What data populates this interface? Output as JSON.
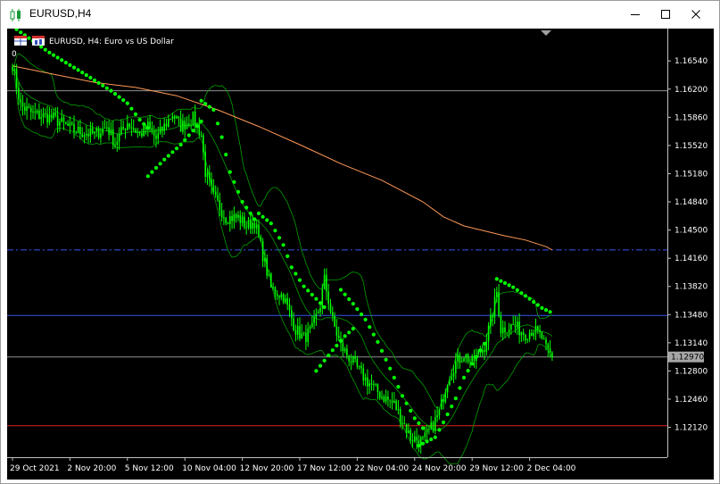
{
  "window": {
    "title": "EURUSD,H4",
    "minimize_icon": "minimize-icon",
    "maximize_icon": "maximize-icon",
    "close_icon": "close-icon"
  },
  "chart_info": {
    "symbol_line": "EURUSD, H4:  Euro vs US Dollar",
    "indicator_zero": "0"
  },
  "colors": {
    "background": "#000000",
    "candle": "#00ff00",
    "sar": "#00ff00",
    "bands": "#00a000",
    "ma": "#ff9955",
    "grid": "#606060",
    "price_label_bg": "#a6a6a6",
    "hline_blue": "#3355ee",
    "hline_red": "#dd2222",
    "hline_gray": "#909090"
  },
  "chart_data": {
    "type": "candlestick",
    "symbol": "EURUSD",
    "timeframe": "H4",
    "x_tick_labels": [
      "29 Oct 2021",
      "2 Nov 20:00",
      "5 Nov 12:00",
      "10 Nov 04:00",
      "12 Nov 20:00",
      "17 Nov 12:00",
      "22 Nov 04:00",
      "24 Nov 20:00",
      "29 Nov 12:00",
      "2 Dec 04:00"
    ],
    "y_ticks": [
      1.1654,
      1.162,
      1.1586,
      1.1552,
      1.1518,
      1.1484,
      1.145,
      1.1416,
      1.1382,
      1.1348,
      1.1314,
      1.128,
      1.1246,
      1.1212
    ],
    "y_tick_labels": [
      "1.16540",
      "1.16200",
      "1.15860",
      "1.15520",
      "1.15180",
      "1.14840",
      "1.14500",
      "1.14160",
      "1.13820",
      "1.13480",
      "1.13140",
      "1.12800",
      "1.12460",
      "1.12120"
    ],
    "ylim": [
      1.1176,
      1.1693
    ],
    "current_price": 1.1297,
    "current_price_label": "1.12970",
    "horizontal_lines": [
      {
        "price": 1.1618,
        "style": "solid",
        "color": "gray"
      },
      {
        "price": 1.1426,
        "style": "dash-dot",
        "color": "blue"
      },
      {
        "price": 1.1347,
        "style": "solid",
        "color": "blue"
      },
      {
        "price": 1.1297,
        "style": "solid",
        "color": "gray"
      },
      {
        "price": 1.1214,
        "style": "solid",
        "color": "red"
      }
    ],
    "close_path": [
      [
        0,
        1.165
      ],
      [
        4,
        1.16
      ],
      [
        10,
        1.159
      ],
      [
        20,
        1.1585
      ],
      [
        30,
        1.157
      ],
      [
        40,
        1.1565
      ],
      [
        46,
        1.1575
      ],
      [
        50,
        1.1555
      ],
      [
        56,
        1.158
      ],
      [
        62,
        1.1565
      ],
      [
        66,
        1.1575
      ],
      [
        70,
        1.156
      ],
      [
        78,
        1.159
      ],
      [
        82,
        1.1575
      ],
      [
        88,
        1.1585
      ],
      [
        92,
        1.1565
      ],
      [
        94,
        1.152
      ],
      [
        98,
        1.149
      ],
      [
        104,
        1.1465
      ],
      [
        110,
        1.1465
      ],
      [
        114,
        1.1455
      ],
      [
        118,
        1.146
      ],
      [
        122,
        1.142
      ],
      [
        126,
        1.138
      ],
      [
        132,
        1.137
      ],
      [
        138,
        1.133
      ],
      [
        142,
        1.132
      ],
      [
        146,
        1.133
      ],
      [
        150,
        1.136
      ],
      [
        152,
        1.139
      ],
      [
        156,
        1.134
      ],
      [
        160,
        1.131
      ],
      [
        166,
        1.129
      ],
      [
        172,
        1.127
      ],
      [
        176,
        1.126
      ],
      [
        180,
        1.125
      ],
      [
        186,
        1.124
      ],
      [
        190,
        1.122
      ],
      [
        194,
        1.12
      ],
      [
        200,
        1.1195
      ],
      [
        205,
        1.1215
      ],
      [
        208,
        1.123
      ],
      [
        212,
        1.127
      ],
      [
        216,
        1.129
      ],
      [
        220,
        1.13
      ],
      [
        224,
        1.129
      ],
      [
        230,
        1.131
      ],
      [
        234,
        1.135
      ],
      [
        236,
        1.1375
      ],
      [
        238,
        1.133
      ],
      [
        244,
        1.1335
      ],
      [
        250,
        1.1325
      ],
      [
        254,
        1.133
      ],
      [
        258,
        1.132
      ],
      [
        260,
        1.1305
      ],
      [
        263,
        1.1297
      ]
    ],
    "ma_path": [
      [
        0,
        1.1648
      ],
      [
        20,
        1.1638
      ],
      [
        40,
        1.1628
      ],
      [
        60,
        1.1622
      ],
      [
        80,
        1.1612
      ],
      [
        100,
        1.1595
      ],
      [
        120,
        1.1575
      ],
      [
        140,
        1.1553
      ],
      [
        160,
        1.153
      ],
      [
        180,
        1.151
      ],
      [
        200,
        1.1484
      ],
      [
        210,
        1.1466
      ],
      [
        220,
        1.1455
      ],
      [
        240,
        1.1443
      ],
      [
        250,
        1.1438
      ],
      [
        260,
        1.143
      ],
      [
        263,
        1.1426
      ]
    ],
    "sar_segments": [
      [
        [
          2,
          1.1692
        ],
        [
          18,
          1.1664
        ],
        [
          34,
          1.164
        ],
        [
          48,
          1.1618
        ],
        [
          56,
          1.1603
        ],
        [
          62,
          1.1583
        ],
        [
          66,
          1.1573
        ]
      ],
      [
        [
          66,
          1.1515
        ],
        [
          74,
          1.1535
        ],
        [
          82,
          1.1553
        ],
        [
          88,
          1.157
        ],
        [
          92,
          1.1581
        ]
      ],
      [
        [
          92,
          1.1606
        ],
        [
          98,
          1.1595
        ],
        [
          102,
          1.1562
        ],
        [
          106,
          1.152
        ],
        [
          112,
          1.1484
        ],
        [
          118,
          1.1463
        ]
      ],
      [
        [
          120,
          1.147
        ],
        [
          126,
          1.1458
        ],
        [
          132,
          1.1432
        ],
        [
          136,
          1.1405
        ],
        [
          142,
          1.1382
        ],
        [
          150,
          1.1362
        ],
        [
          152,
          1.1357
        ]
      ],
      [
        [
          148,
          1.128
        ],
        [
          156,
          1.1305
        ],
        [
          162,
          1.1322
        ],
        [
          166,
          1.1331
        ]
      ],
      [
        [
          160,
          1.1378
        ],
        [
          166,
          1.1361
        ],
        [
          172,
          1.1342
        ],
        [
          178,
          1.1315
        ],
        [
          184,
          1.1283
        ],
        [
          190,
          1.125
        ],
        [
          196,
          1.1223
        ],
        [
          200,
          1.1211
        ]
      ],
      [
        [
          198,
          1.119
        ],
        [
          206,
          1.12
        ],
        [
          210,
          1.1218
        ],
        [
          216,
          1.1247
        ],
        [
          220,
          1.1272
        ],
        [
          226,
          1.1297
        ],
        [
          230,
          1.1313
        ]
      ],
      [
        [
          236,
          1.1391
        ],
        [
          244,
          1.1381
        ],
        [
          252,
          1.1367
        ],
        [
          258,
          1.1356
        ],
        [
          263,
          1.135
        ]
      ]
    ]
  }
}
